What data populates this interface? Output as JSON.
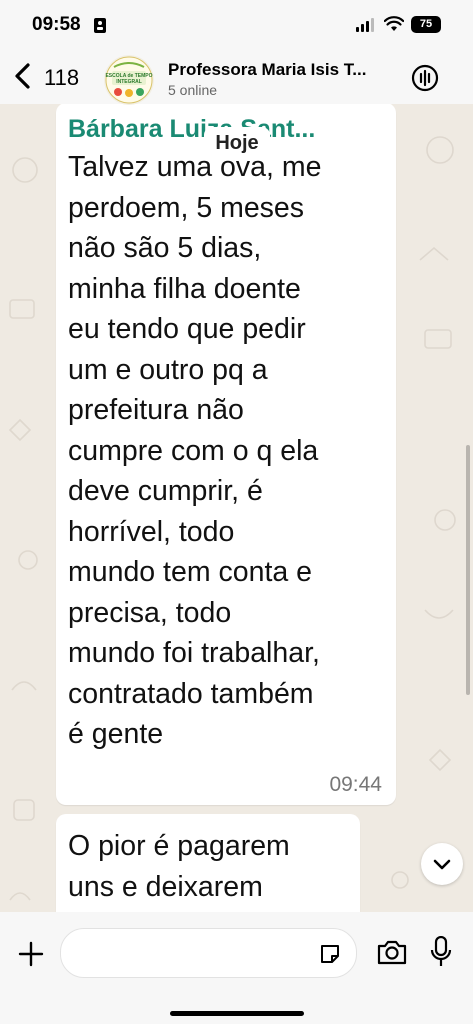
{
  "status_bar": {
    "time": "09:58",
    "battery": "75"
  },
  "header": {
    "back_count": "118",
    "title": "Professora Maria Isis T...",
    "subtitle": "5 online",
    "avatar_text": "ESCOLA de TEMPO INTEGRAL"
  },
  "date_chip": "Hoje",
  "messages": [
    {
      "sender": "Bárbara Luiza Sant...",
      "lines": [
        "Talvez uma ova, me",
        "perdoem, 5 meses",
        "não são 5 dias,",
        "minha filha doente",
        "eu tendo que pedir",
        "um e outro pq a",
        "prefeitura não",
        "cumpre com o q ela",
        "deve cumprir, é",
        "horrível, todo",
        "mundo tem conta e",
        "precisa, todo",
        "mundo foi trabalhar,",
        "contratado também",
        "é gente"
      ],
      "time": "09:44"
    },
    {
      "lines": [
        "O pior é pagarem",
        "uns e deixarem"
      ]
    }
  ],
  "input": {
    "placeholder": ""
  },
  "colors": {
    "sender": "#1a8a73",
    "wallpaper": "#efeae2"
  }
}
